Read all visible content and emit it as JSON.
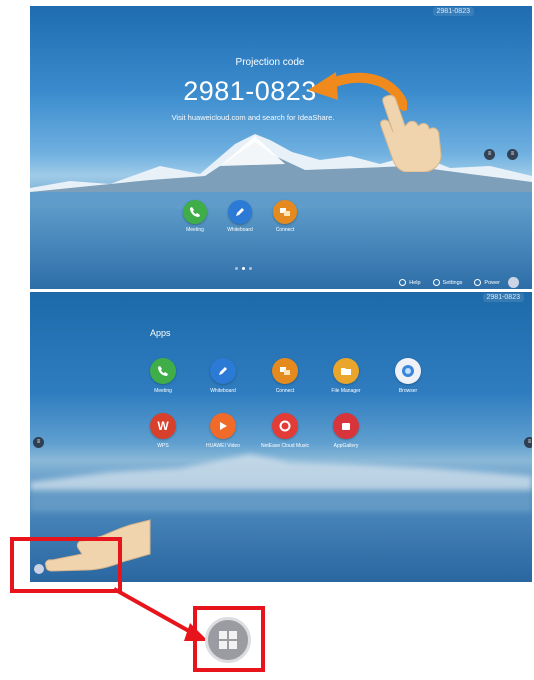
{
  "screen1": {
    "code_tag": "2981-0823",
    "projection_title": "Projection code",
    "projection_code": "2981-0823",
    "hint": "Visit huaweicloud.com and search for IdeaShare.",
    "dock": [
      {
        "label": "Meeting",
        "icon": "phone-icon",
        "color": "#3fae49"
      },
      {
        "label": "Whiteboard",
        "icon": "pen-icon",
        "color": "#2b7ad6"
      },
      {
        "label": "Connect",
        "icon": "connect-icon",
        "color": "#e58a1f"
      }
    ],
    "bottom_bar": {
      "help": "Help",
      "settings": "Settings",
      "power": "Power"
    }
  },
  "screen2": {
    "code_tag": "2981-0823",
    "apps_title": "Apps",
    "apps_row1": [
      {
        "label": "Meeting",
        "icon": "phone-icon",
        "color": "#3fae49"
      },
      {
        "label": "Whiteboard",
        "icon": "pen-icon",
        "color": "#2b7ad6"
      },
      {
        "label": "Connect",
        "icon": "connect-icon",
        "color": "#e58a1f"
      },
      {
        "label": "File Manager",
        "icon": "folder-icon",
        "color": "#e9a52c"
      },
      {
        "label": "Browser",
        "icon": "browser-icon",
        "color": "#eef1f6"
      }
    ],
    "apps_row2": [
      {
        "label": "WPS",
        "icon": "wps-icon",
        "color": "#d9402b"
      },
      {
        "label": "HUAWEI Video",
        "icon": "play-icon",
        "color": "#f06a2a"
      },
      {
        "label": "NetEase Cloud Music",
        "icon": "music-icon",
        "color": "#e33b35"
      },
      {
        "label": "AppGallery",
        "icon": "appgallery-icon",
        "color": "#d8343b"
      }
    ]
  },
  "annotations": {
    "highlight_color": "#e8141c",
    "zoomed_icon": "windows-start-icon"
  }
}
